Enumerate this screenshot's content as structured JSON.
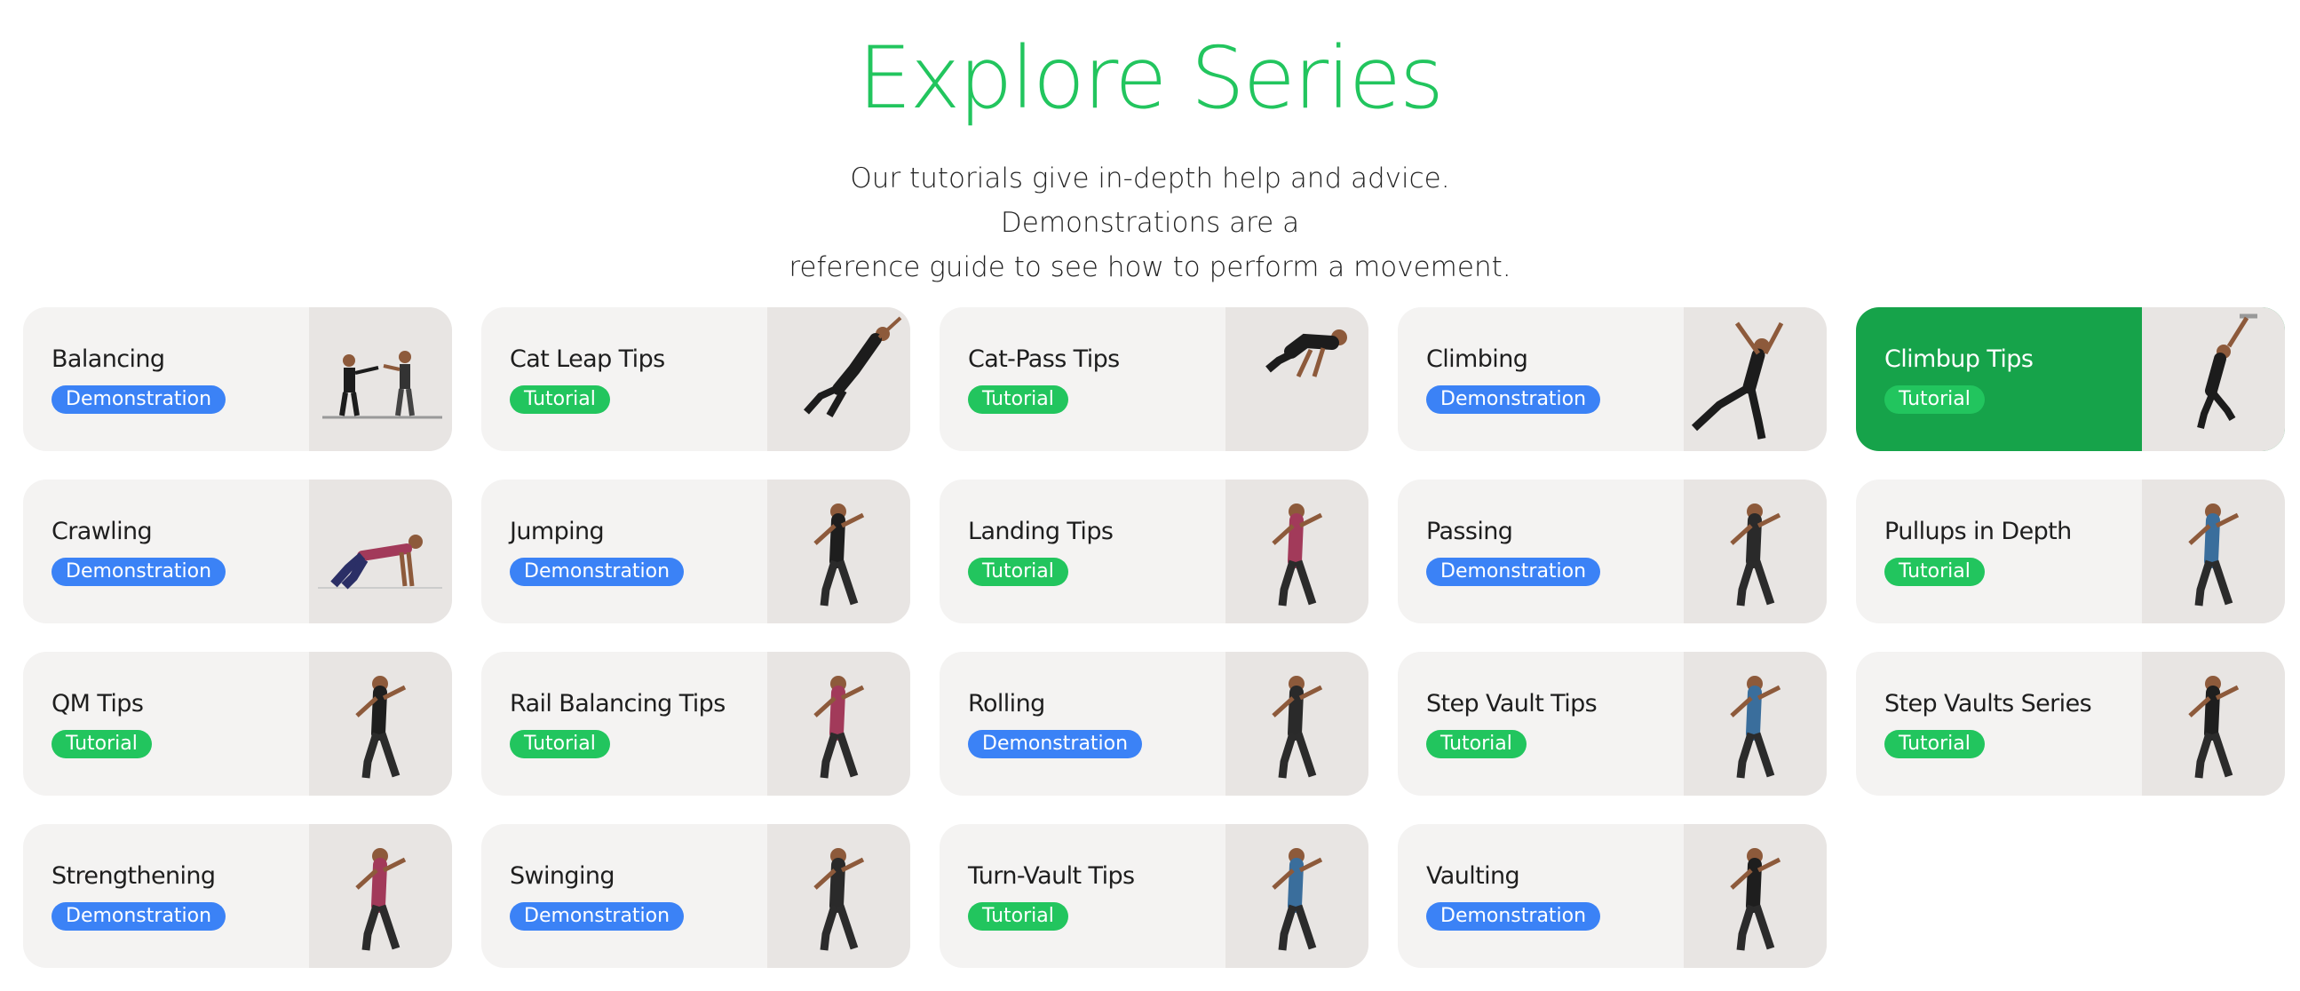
{
  "header": {
    "title": "Explore Series",
    "subtitle_line1": "Our tutorials give in-depth help and advice. Demonstrations are a",
    "subtitle_line2": "reference guide to see how to perform a movement."
  },
  "colors": {
    "accent_green": "#22c55e",
    "active_card_green": "#16a34a",
    "tutorial_badge": "#22c55e",
    "demonstration_badge": "#3b82f6"
  },
  "cards": [
    {
      "title": "Balancing",
      "badge": "Demonstration",
      "image": "two-people-balancing-image"
    },
    {
      "title": "Cat Leap Tips",
      "badge": "Tutorial",
      "image": "person-leaping-image"
    },
    {
      "title": "Cat-Pass Tips",
      "badge": "Tutorial",
      "image": "person-vaulting-image"
    },
    {
      "title": "Climbing",
      "badge": "Demonstration",
      "image": "person-climbing-image"
    },
    {
      "title": "Climbup Tips",
      "badge": "Tutorial",
      "image": "person-climbup-image",
      "active": true
    },
    {
      "title": "Crawling",
      "badge": "Demonstration",
      "image": "person-crawling-image"
    },
    {
      "title": "Jumping",
      "badge": "Demonstration",
      "image": "person-jumping-image"
    },
    {
      "title": "Landing Tips",
      "badge": "Tutorial",
      "image": "person-landing-image"
    },
    {
      "title": "Passing",
      "badge": "Demonstration",
      "image": "person-passing-image"
    },
    {
      "title": "Pullups in Depth",
      "badge": "Tutorial",
      "image": "person-pullup-image"
    },
    {
      "title": "QM Tips",
      "badge": "Tutorial",
      "image": "person-quadrupedal-image"
    },
    {
      "title": "Rail Balancing Tips",
      "badge": "Tutorial",
      "image": "person-rail-balancing-image"
    },
    {
      "title": "Rolling",
      "badge": "Demonstration",
      "image": "person-rolling-image"
    },
    {
      "title": "Step Vault Tips",
      "badge": "Tutorial",
      "image": "person-step-vault-image"
    },
    {
      "title": "Step Vaults Series",
      "badge": "Tutorial",
      "image": "person-step-vault-bar-image"
    },
    {
      "title": "Strengthening",
      "badge": "Demonstration",
      "image": "person-strengthening-image"
    },
    {
      "title": "Swinging",
      "badge": "Demonstration",
      "image": "person-swinging-image"
    },
    {
      "title": "Turn-Vault Tips",
      "badge": "Tutorial",
      "image": "person-turn-vault-image"
    },
    {
      "title": "Vaulting",
      "badge": "Demonstration",
      "image": "person-vaulting-box-image"
    }
  ]
}
